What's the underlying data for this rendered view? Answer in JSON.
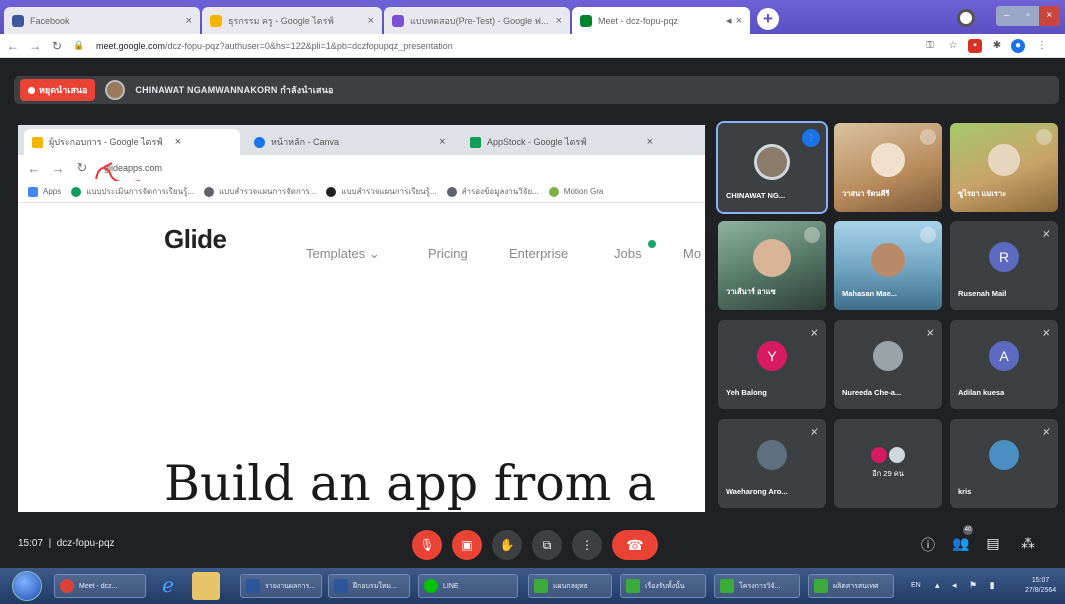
{
  "outer_browser": {
    "tabs": [
      {
        "title": "Facebook",
        "color": "#3b5998"
      },
      {
        "title": "ธุรกรรม ครู - Google ไดรฟ์",
        "color": "#f4b400"
      },
      {
        "title": "แบบทดสอบ(Pre-Test) - Google ฟ...",
        "color": "#7b4fd6"
      },
      {
        "title": "Meet - dcz-fopu-pqz",
        "color": "#00832d"
      }
    ],
    "url_host": "meet.google.com",
    "url_path": "/dcz-fopu-pqz?authuser=0&hs=122&pli=1&pb=dczfopupqz_presentation"
  },
  "meet": {
    "stop_label": "หยุดนำเสนอ",
    "presenter": "CHINAWAT NGAMWANNAKORN กำลังนำเสนอ",
    "clock": "15:07",
    "meeting_code": "dcz-fopu-pqz",
    "people_count": "40"
  },
  "shared_screen": {
    "tabs": [
      {
        "title": "ผู้ประกอบการ - Google ไดรฟ์",
        "color": "#f4b400"
      },
      {
        "title": "หน้าหลัก - Canva",
        "color": "#1a73e8"
      },
      {
        "title": "AppStock - Google ไดรฟ์",
        "color": "#0f9d58"
      }
    ],
    "url": "glideapps.com",
    "bookmarks": [
      {
        "label": "Apps",
        "color": "#4285f4"
      },
      {
        "label": "แบบประเมินการจัดการเรียนรู้...",
        "color": "#0f9d58"
      },
      {
        "label": "แบบสำรวจแผนการจัดการ...",
        "color": "#5f6368"
      },
      {
        "label": "แบบสำรวจแผนการเรียนรู้...",
        "color": "#222222"
      },
      {
        "label": "สำรองข้อมูลงานวิจัย...",
        "color": "#5f6368"
      },
      {
        "label": "Motion Gra",
        "color": "#7cb342"
      }
    ],
    "logo": "Glide",
    "nav": [
      "Templates ⌄",
      "Pricing",
      "Enterprise",
      "Jobs",
      "Mo"
    ],
    "hero": "Build an app from a"
  },
  "participants": [
    {
      "name": "CHINAWAT NG...",
      "type": "photo",
      "color": "#8a7b6a"
    },
    {
      "name": "วาสนา รัตนคีรี",
      "type": "photo",
      "color": "#b88a5a"
    },
    {
      "name": "ซูไรยา แมเราะ",
      "type": "photo",
      "color": "#c9a26a"
    },
    {
      "name": "วาเส้นาร์ อาแซ",
      "type": "photo",
      "color": "#6f8d7a"
    },
    {
      "name": "Mahasan Mae...",
      "type": "photo",
      "color": "#6fa3bf"
    },
    {
      "name": "Rusenah Mail",
      "type": "avatar",
      "initial": "R",
      "color": "#5c6bc0"
    },
    {
      "name": "Yeh Balong",
      "type": "avatar",
      "initial": "Y",
      "color": "#d81b60"
    },
    {
      "name": "Nureeda Che-a...",
      "type": "photo-small",
      "color": "#9aa3a8"
    },
    {
      "name": "Adilan kuesa",
      "type": "avatar",
      "initial": "A",
      "color": "#5c6bc0"
    },
    {
      "name": "Waeharong Aro...",
      "type": "photo-small",
      "color": "#5f6f80"
    },
    {
      "name": "อีก 29 คน",
      "type": "group",
      "color": "#d81b60"
    },
    {
      "name": "kris",
      "type": "photo-small",
      "color": "#4a90c2"
    }
  ],
  "taskbar": {
    "tasks": [
      "Meet - dcz...",
      "รายงานผลการ...",
      "ฝึกอบรมใหม...",
      "LINE",
      "แผนกลยุทธ",
      "เรื่องรับทั้งนั้น",
      "โครงการวิจั...",
      "ผลิตสารสนเทศ"
    ],
    "lang": "EN",
    "time": "15:07",
    "date": "27/8/2564"
  }
}
